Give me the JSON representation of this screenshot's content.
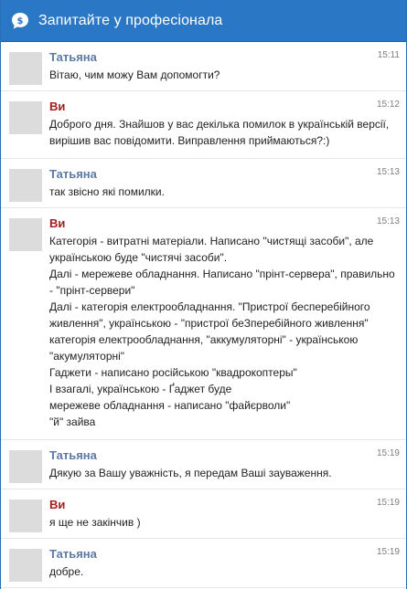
{
  "header": {
    "title": "Запитайте у професіонала",
    "icon": "chat-bubble-icon",
    "background": "#2a77c6"
  },
  "messages": [
    {
      "author": "Татьяна",
      "role": "agent",
      "time": "15:11",
      "lines": [
        "Вітаю, чим можу Вам допомогти?"
      ]
    },
    {
      "author": "Ви",
      "role": "user",
      "time": "15:12",
      "lines": [
        "Доброго дня. Знайшов у вас декілька помилок в українській версії,",
        "вирішив вас повідомити. Виправлення приймаються?:)"
      ]
    },
    {
      "author": "Татьяна",
      "role": "agent",
      "time": "15:13",
      "lines": [
        "так звісно які помилки."
      ]
    },
    {
      "author": "Ви",
      "role": "user",
      "time": "15:13",
      "lines": [
        "Категорія - витратні матеріали. Написано \"чистящі засоби\", але",
        "українською буде \"чистячі засоби\".",
        "Далі - мережеве обладнання. Написано \"прінт-сервера\", правильно",
        "- \"прінт-сервери\"",
        "Далі - категорія електрообладнання. \"Пристрої бесперебійного",
        "живлення\", українською - \"пристрої беЗперебійного живлення\"",
        "категорія електрообладнання, \"аккумуляторні\" - українською",
        "\"акумуляторні\"",
        "Гаджети - написано російською \"квадрокоптеры\"",
        "І взагалі, українською - Ґаджет буде",
        "мережеве обладнання - написано \"файєрволи\"",
        "\"й\" зайва"
      ]
    },
    {
      "author": "Татьяна",
      "role": "agent",
      "time": "15:19",
      "lines": [
        "Дякую за Вашу уважність, я передам Ваші зауваження."
      ]
    },
    {
      "author": "Ви",
      "role": "user",
      "time": "15:19",
      "lines": [
        "я ще не закінчив )"
      ]
    },
    {
      "author": "Татьяна",
      "role": "agent",
      "time": "15:19",
      "lines": [
        "добре."
      ]
    }
  ]
}
